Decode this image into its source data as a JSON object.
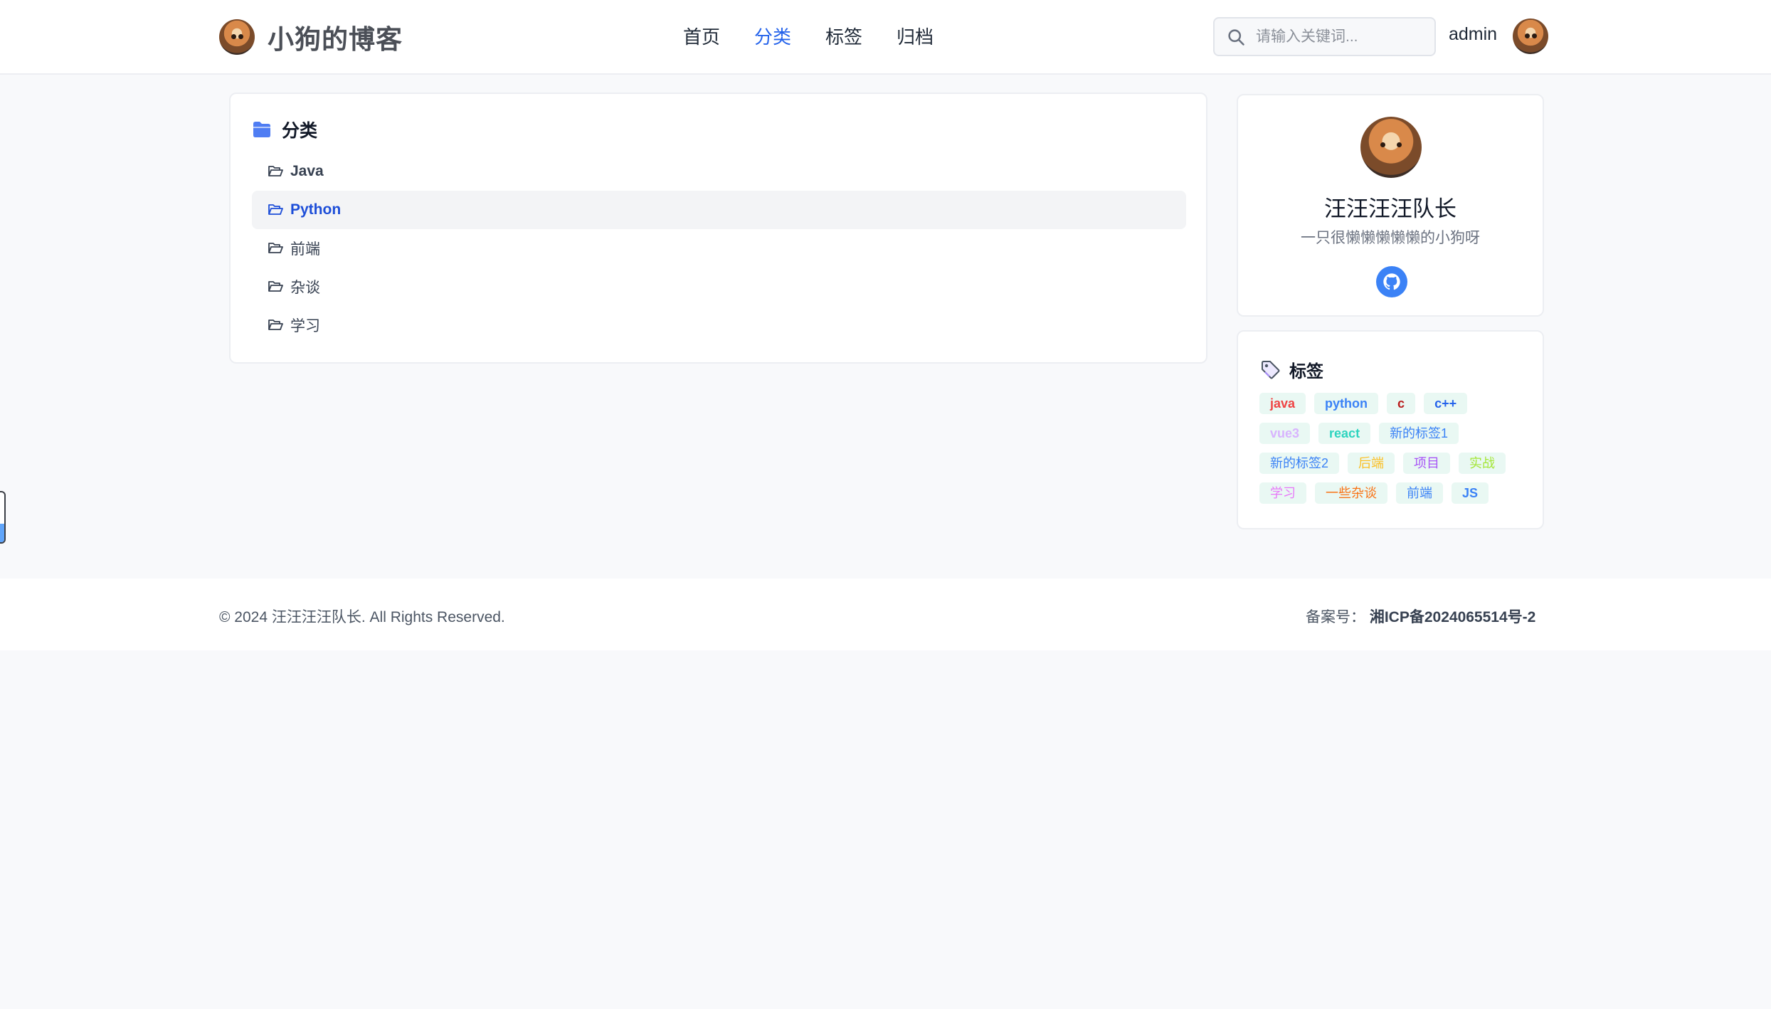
{
  "header": {
    "brand_title": "小狗的博客",
    "nav": [
      {
        "label": "首页",
        "active": false
      },
      {
        "label": "分类",
        "active": true
      },
      {
        "label": "标签",
        "active": false
      },
      {
        "label": "归档",
        "active": false
      }
    ],
    "search_placeholder": "请输入关键词...",
    "username": "admin"
  },
  "categories": {
    "title": "分类",
    "items": [
      {
        "label": "Java",
        "active": false
      },
      {
        "label": "Python",
        "active": true
      },
      {
        "label": "前端",
        "active": false
      },
      {
        "label": "杂谈",
        "active": false
      },
      {
        "label": "学习",
        "active": false
      }
    ]
  },
  "profile": {
    "name": "汪汪汪汪队长",
    "description": "一只很懒懒懒懒懒的小狗呀",
    "social_icon": "github-icon"
  },
  "tags": {
    "title": "标签",
    "items": [
      {
        "label": "java",
        "color": "#ef4444",
        "bg": "#e9f8f3"
      },
      {
        "label": "python",
        "color": "#3b82f6",
        "bg": "#e9f8f3"
      },
      {
        "label": "c",
        "color": "#b91c1c",
        "bg": "#e9f8f3"
      },
      {
        "label": "c++",
        "color": "#2563eb",
        "bg": "#e9f8f3"
      },
      {
        "label": "vue3",
        "color": "#d8b4fe",
        "bg": "#e9f8f3"
      },
      {
        "label": "react",
        "color": "#2dd4bf",
        "bg": "#e9f8f3"
      },
      {
        "label": "新的标签1",
        "color": "#3b82f6",
        "bg": "#e9f8f3"
      },
      {
        "label": "新的标签2",
        "color": "#3b82f6",
        "bg": "#e9f8f3"
      },
      {
        "label": "后端",
        "color": "#fbbf24",
        "bg": "#e9f8f3"
      },
      {
        "label": "项目",
        "color": "#a855f7",
        "bg": "#e9f8f3"
      },
      {
        "label": "实战",
        "color": "#a3e635",
        "bg": "#e9f8f3"
      },
      {
        "label": "学习",
        "color": "#e879f9",
        "bg": "#e9f8f3"
      },
      {
        "label": "一些杂谈",
        "color": "#f97316",
        "bg": "#e9f8f3"
      },
      {
        "label": "前端",
        "color": "#3b82f6",
        "bg": "#e9f8f3"
      },
      {
        "label": "JS",
        "color": "#3b82f6",
        "bg": "#e9f8f3"
      }
    ]
  },
  "footer": {
    "copyright": "© 2024 汪汪汪汪队长. All Rights Reserved.",
    "icp_label": "备案号：",
    "icp_number": "湘ICP备2024065514号-2"
  },
  "colors": {
    "accent": "#2563eb",
    "page_bg": "#f8f9fb",
    "card_bg": "#ffffff",
    "github_button": "#3b82f6"
  }
}
